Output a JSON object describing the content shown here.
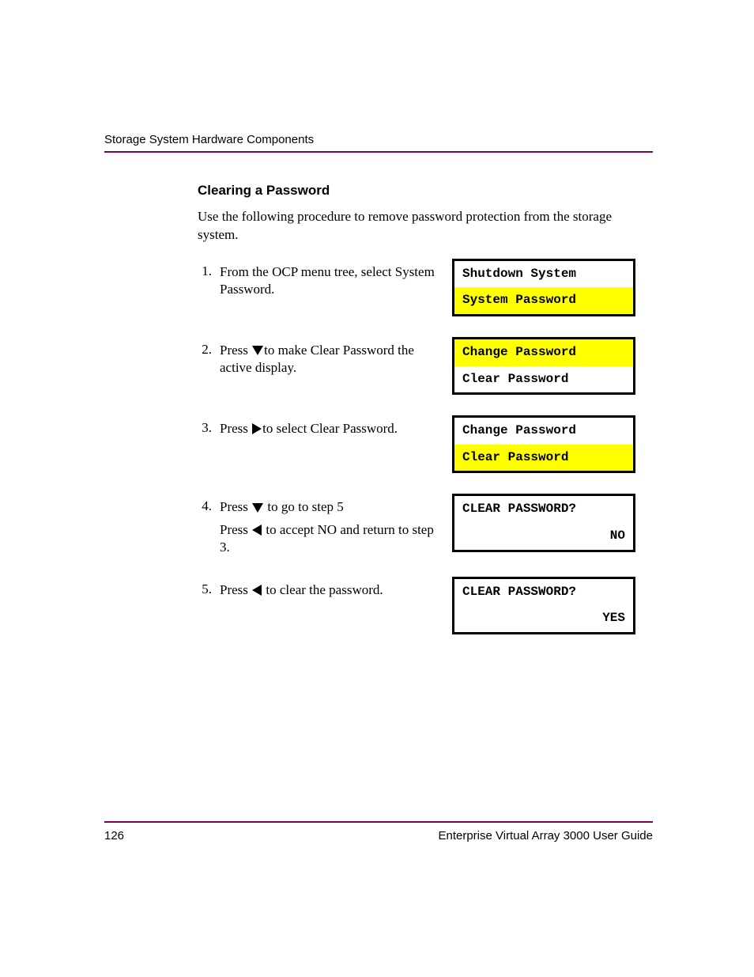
{
  "header": {
    "section": "Storage System Hardware Components"
  },
  "title": "Clearing a Password",
  "intro": "Use the following procedure to remove password protection from the storage system.",
  "steps": {
    "s1": {
      "num": "1.",
      "text": "From the OCP menu tree, select System Password.",
      "lcd": {
        "r1": "Shutdown System",
        "r2": "System Password"
      }
    },
    "s2": {
      "num": "2.",
      "pre": "Press ",
      "post": "to make Clear Password the active display.",
      "lcd": {
        "r1": "Change Password",
        "r2": "Clear Password"
      }
    },
    "s3": {
      "num": "3.",
      "pre": "Press ",
      "post": "to select Clear Password.",
      "lcd": {
        "r1": "Change Password",
        "r2": "Clear Password"
      }
    },
    "s4": {
      "num": "4.",
      "line1_pre": "Press ",
      "line1_post": " to go to step 5",
      "line2_pre": "Press ",
      "line2_post": " to accept NO and return to step 3.",
      "lcd": {
        "r1": "CLEAR PASSWORD?",
        "r2": "NO"
      }
    },
    "s5": {
      "num": "5.",
      "pre": "Press ",
      "post": " to clear the password.",
      "lcd": {
        "r1": "CLEAR PASSWORD?",
        "r2": "YES"
      }
    }
  },
  "footer": {
    "page": "126",
    "doc": "Enterprise Virtual Array 3000 User Guide"
  }
}
